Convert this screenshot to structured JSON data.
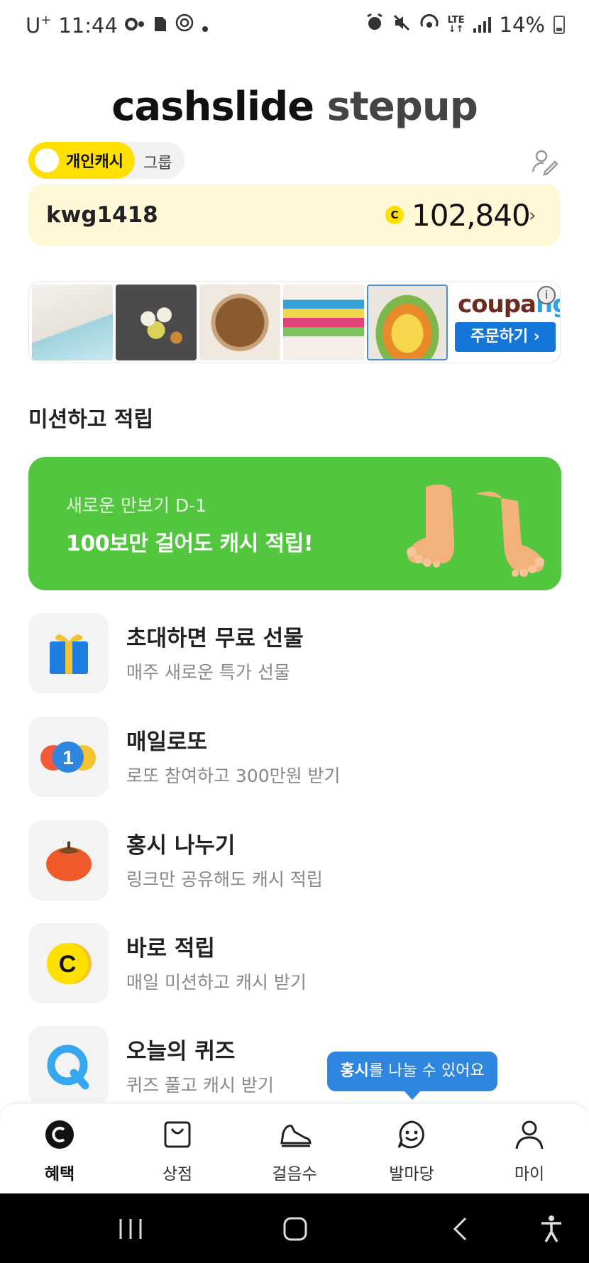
{
  "status_bar": {
    "carrier": "U",
    "carrier_sup": "+",
    "time": "11:44",
    "net_type": "LTE",
    "battery": "14%"
  },
  "header": {
    "title_part1": "cashslide",
    "title_part2": "stepup",
    "toggle_active": "개인캐시",
    "toggle_inactive": "그룹"
  },
  "balance": {
    "user_id": "kwg1418",
    "coin_symbol": "C",
    "amount": "102,840"
  },
  "ad": {
    "brand_logo_part1": "coupa",
    "brand_logo_part2": "ng",
    "order_button": "주문하기 ›",
    "info_symbol": "i"
  },
  "section": {
    "title": "미션하고 적립"
  },
  "promo": {
    "subtitle": "새로운 만보기 D-1",
    "title": "100보만 걸어도 캐시 적립!"
  },
  "missions": [
    {
      "title": "초대하면 무료 선물",
      "desc": "매주 새로운 특가 선물",
      "icon": "gift-icon"
    },
    {
      "title": "매일로또",
      "desc": "로또 참여하고 300만원 받기",
      "icon": "lotto-icon",
      "badge": "1"
    },
    {
      "title": "홍시 나누기",
      "desc": "링크만 공유해도 캐시 적립",
      "icon": "persimmon-icon"
    },
    {
      "title": "바로 적립",
      "desc": "매일 미션하고 캐시 받기",
      "icon": "cash-coin-icon",
      "badge": "C"
    },
    {
      "title": "오늘의 퀴즈",
      "desc": "퀴즈 풀고 캐시 받기",
      "icon": "quiz-icon"
    }
  ],
  "tooltip": {
    "bold": "홍시",
    "rest": "를 나눌 수 있어요"
  },
  "bottom_nav": [
    {
      "label": "혜택",
      "icon": "benefit-icon",
      "active": true
    },
    {
      "label": "상점",
      "icon": "shop-bag-icon",
      "active": false
    },
    {
      "label": "걸음수",
      "icon": "shoe-icon",
      "active": false
    },
    {
      "label": "발마당",
      "icon": "smile-chat-icon",
      "active": false
    },
    {
      "label": "마이",
      "icon": "person-icon",
      "active": false
    }
  ],
  "colors": {
    "brand_yellow": "#ffe000",
    "balance_bg": "#fff8d6",
    "promo_green": "#52c63f",
    "tooltip_blue": "#2e86de",
    "coupang_blue": "#1476d8"
  }
}
